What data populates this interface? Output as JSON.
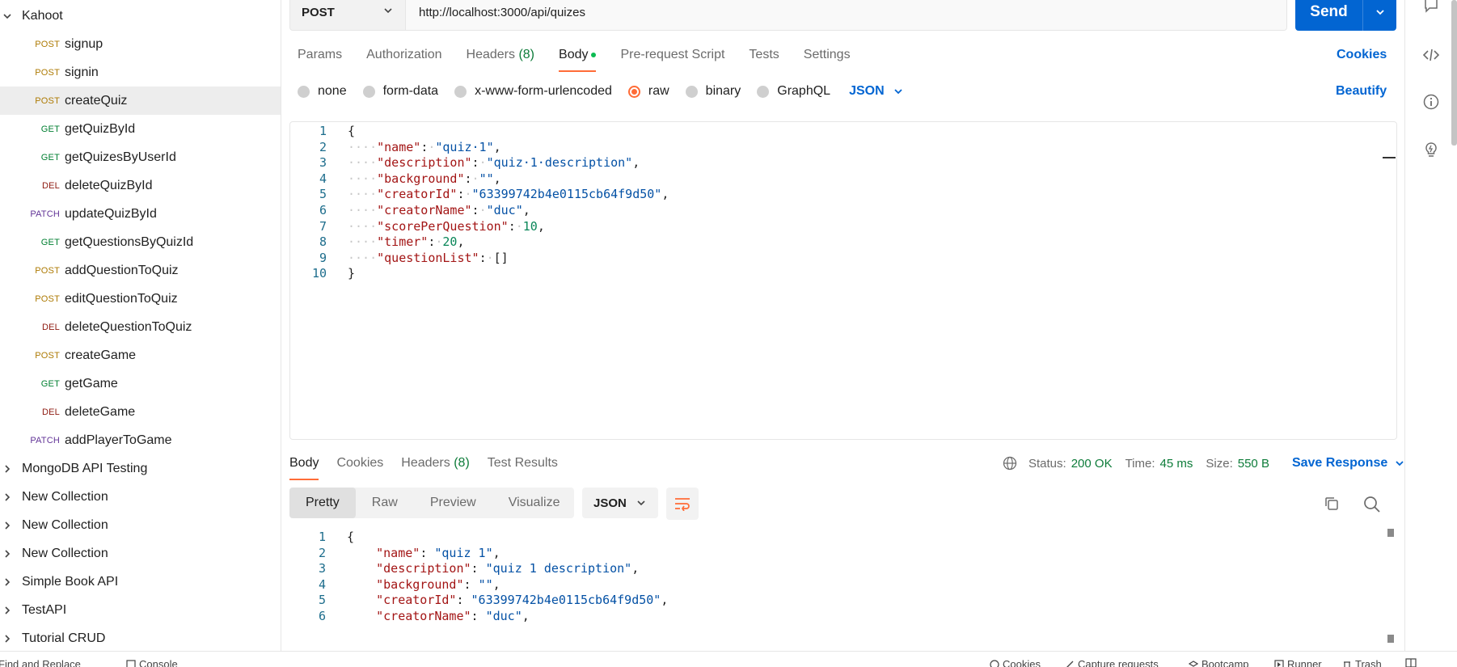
{
  "sidebar": {
    "collections_top": [
      {
        "label": "Kahoot",
        "expanded": true
      }
    ],
    "requests": [
      {
        "method": "POST",
        "label": "signup"
      },
      {
        "method": "POST",
        "label": "signin"
      },
      {
        "method": "POST",
        "label": "createQuiz",
        "selected": true
      },
      {
        "method": "GET",
        "label": "getQuizById"
      },
      {
        "method": "GET",
        "label": "getQuizesByUserId"
      },
      {
        "method": "DEL",
        "label": "deleteQuizById"
      },
      {
        "method": "PATCH",
        "label": "updateQuizById"
      },
      {
        "method": "GET",
        "label": "getQuestionsByQuizId"
      },
      {
        "method": "POST",
        "label": "addQuestionToQuiz"
      },
      {
        "method": "POST",
        "label": "editQuestionToQuiz"
      },
      {
        "method": "DEL",
        "label": "deleteQuestionToQuiz"
      },
      {
        "method": "POST",
        "label": "createGame"
      },
      {
        "method": "GET",
        "label": "getGame"
      },
      {
        "method": "DEL",
        "label": "deleteGame"
      },
      {
        "method": "PATCH",
        "label": "addPlayerToGame"
      }
    ],
    "collections": [
      {
        "label": "MongoDB API Testing"
      },
      {
        "label": "New Collection"
      },
      {
        "label": "New Collection"
      },
      {
        "label": "New Collection"
      },
      {
        "label": "Simple Book API"
      },
      {
        "label": "TestAPI"
      },
      {
        "label": "Tutorial CRUD"
      }
    ]
  },
  "request": {
    "method": "POST",
    "url": "http://localhost:3000/api/quizes",
    "send_label": "Send"
  },
  "request_tabs": {
    "params": "Params",
    "authorization": "Authorization",
    "headers": "Headers",
    "headers_count": "(8)",
    "body": "Body",
    "pre_request": "Pre-request Script",
    "tests": "Tests",
    "settings": "Settings",
    "cookies": "Cookies"
  },
  "body_types": {
    "none": "none",
    "form_data": "form-data",
    "urlencoded": "x-www-form-urlencoded",
    "raw": "raw",
    "binary": "binary",
    "graphql": "GraphQL",
    "lang": "JSON",
    "beautify": "Beautify"
  },
  "request_body": {
    "line_numbers": [
      "1",
      "2",
      "3",
      "4",
      "5",
      "6",
      "7",
      "8",
      "9",
      "10"
    ],
    "lines": [
      [
        {
          "t": "p",
          "v": "{"
        }
      ],
      [
        {
          "t": "ws",
          "v": "····"
        },
        {
          "t": "k",
          "v": "\"name\""
        },
        {
          "t": "p",
          "v": ":"
        },
        {
          "t": "ws",
          "v": "·"
        },
        {
          "t": "s",
          "v": "\"quiz·1\""
        },
        {
          "t": "p",
          "v": ","
        }
      ],
      [
        {
          "t": "ws",
          "v": "····"
        },
        {
          "t": "k",
          "v": "\"description\""
        },
        {
          "t": "p",
          "v": ":"
        },
        {
          "t": "ws",
          "v": "·"
        },
        {
          "t": "s",
          "v": "\"quiz·1·description\""
        },
        {
          "t": "p",
          "v": ","
        }
      ],
      [
        {
          "t": "ws",
          "v": "····"
        },
        {
          "t": "k",
          "v": "\"background\""
        },
        {
          "t": "p",
          "v": ":"
        },
        {
          "t": "ws",
          "v": "·"
        },
        {
          "t": "s",
          "v": "\"\""
        },
        {
          "t": "p",
          "v": ","
        }
      ],
      [
        {
          "t": "ws",
          "v": "····"
        },
        {
          "t": "k",
          "v": "\"creatorId\""
        },
        {
          "t": "p",
          "v": ":"
        },
        {
          "t": "ws",
          "v": "·"
        },
        {
          "t": "s",
          "v": "\"63399742b4e0115cb64f9d50\""
        },
        {
          "t": "p",
          "v": ","
        }
      ],
      [
        {
          "t": "ws",
          "v": "····"
        },
        {
          "t": "k",
          "v": "\"creatorName\""
        },
        {
          "t": "p",
          "v": ":"
        },
        {
          "t": "ws",
          "v": "·"
        },
        {
          "t": "s",
          "v": "\"duc\""
        },
        {
          "t": "p",
          "v": ","
        }
      ],
      [
        {
          "t": "ws",
          "v": "····"
        },
        {
          "t": "k",
          "v": "\"scorePerQuestion\""
        },
        {
          "t": "p",
          "v": ":"
        },
        {
          "t": "ws",
          "v": "·"
        },
        {
          "t": "n",
          "v": "10"
        },
        {
          "t": "p",
          "v": ","
        }
      ],
      [
        {
          "t": "ws",
          "v": "····"
        },
        {
          "t": "k",
          "v": "\"timer\""
        },
        {
          "t": "p",
          "v": ":"
        },
        {
          "t": "ws",
          "v": "·"
        },
        {
          "t": "n",
          "v": "20"
        },
        {
          "t": "p",
          "v": ","
        }
      ],
      [
        {
          "t": "ws",
          "v": "····"
        },
        {
          "t": "k",
          "v": "\"questionList\""
        },
        {
          "t": "p",
          "v": ":"
        },
        {
          "t": "ws",
          "v": "·"
        },
        {
          "t": "p",
          "v": "[]"
        }
      ],
      [
        {
          "t": "p",
          "v": "}"
        }
      ]
    ]
  },
  "response_tabs": {
    "body": "Body",
    "cookies": "Cookies",
    "headers": "Headers",
    "headers_count": "(8)",
    "test_results": "Test Results"
  },
  "response_meta": {
    "status_label": "Status:",
    "status_value": "200 OK",
    "time_label": "Time:",
    "time_value": "45 ms",
    "size_label": "Size:",
    "size_value": "550 B",
    "save_label": "Save Response"
  },
  "response_view": {
    "pretty": "Pretty",
    "raw": "Raw",
    "preview": "Preview",
    "visualize": "Visualize",
    "lang": "JSON"
  },
  "response_body": {
    "line_numbers": [
      "1",
      "2",
      "3",
      "4",
      "5",
      "6"
    ],
    "lines": [
      [
        {
          "t": "p",
          "v": "{"
        }
      ],
      [
        {
          "t": "p",
          "v": "    "
        },
        {
          "t": "k",
          "v": "\"name\""
        },
        {
          "t": "p",
          "v": ": "
        },
        {
          "t": "s",
          "v": "\"quiz 1\""
        },
        {
          "t": "p",
          "v": ","
        }
      ],
      [
        {
          "t": "p",
          "v": "    "
        },
        {
          "t": "k",
          "v": "\"description\""
        },
        {
          "t": "p",
          "v": ": "
        },
        {
          "t": "s",
          "v": "\"quiz 1 description\""
        },
        {
          "t": "p",
          "v": ","
        }
      ],
      [
        {
          "t": "p",
          "v": "    "
        },
        {
          "t": "k",
          "v": "\"background\""
        },
        {
          "t": "p",
          "v": ": "
        },
        {
          "t": "s",
          "v": "\"\""
        },
        {
          "t": "p",
          "v": ","
        }
      ],
      [
        {
          "t": "p",
          "v": "    "
        },
        {
          "t": "k",
          "v": "\"creatorId\""
        },
        {
          "t": "p",
          "v": ": "
        },
        {
          "t": "s",
          "v": "\"63399742b4e0115cb64f9d50\""
        },
        {
          "t": "p",
          "v": ","
        }
      ],
      [
        {
          "t": "p",
          "v": "    "
        },
        {
          "t": "k",
          "v": "\"creatorName\""
        },
        {
          "t": "p",
          "v": ": "
        },
        {
          "t": "s",
          "v": "\"duc\""
        },
        {
          "t": "p",
          "v": ","
        }
      ]
    ]
  },
  "statusbar": {
    "find_replace": "Find and Replace",
    "console": "Console",
    "cookies": "Cookies",
    "capture": "Capture requests",
    "bootcamp": "Bootcamp",
    "runner": "Runner",
    "trash": "Trash"
  },
  "colors": {
    "accent": "#ff6c37",
    "primary": "#0265d2",
    "success": "#0e7c3a"
  }
}
